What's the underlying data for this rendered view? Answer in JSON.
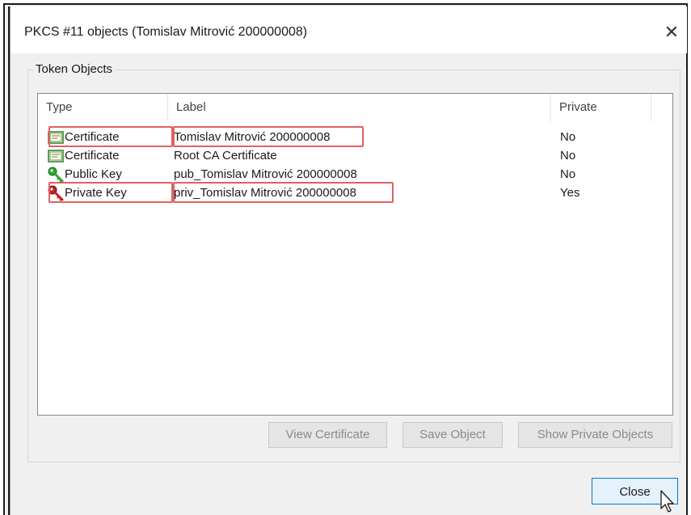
{
  "dialog": {
    "title": "PKCS #11 objects (Tomislav Mitrović 200000008)",
    "close_glyph": "✕"
  },
  "group": {
    "title": "Token Objects"
  },
  "table": {
    "columns": {
      "type": "Type",
      "label": "Label",
      "private": "Private"
    },
    "rows": [
      {
        "type": "Certificate",
        "label": "Tomislav Mitrović 200000008",
        "private": "No",
        "icon": "certificate-icon"
      },
      {
        "type": "Certificate",
        "label": "Root CA Certificate",
        "private": "No",
        "icon": "certificate-icon"
      },
      {
        "type": "Public Key",
        "label": "pub_Tomislav Mitrović 200000008",
        "private": "No",
        "icon": "green-key-icon"
      },
      {
        "type": "Private Key",
        "label": "priv_Tomislav Mitrović 200000008",
        "private": "Yes",
        "icon": "red-key-icon"
      }
    ]
  },
  "buttons": {
    "view_certificate": "View Certificate",
    "save_object": "Save Object",
    "show_private_objects": "Show Private Objects",
    "close": "Close"
  },
  "colors": {
    "highlight": "#e06060",
    "public_key": "#2fa82f",
    "private_key": "#c21f1f",
    "close_button_border": "#0078d7"
  }
}
